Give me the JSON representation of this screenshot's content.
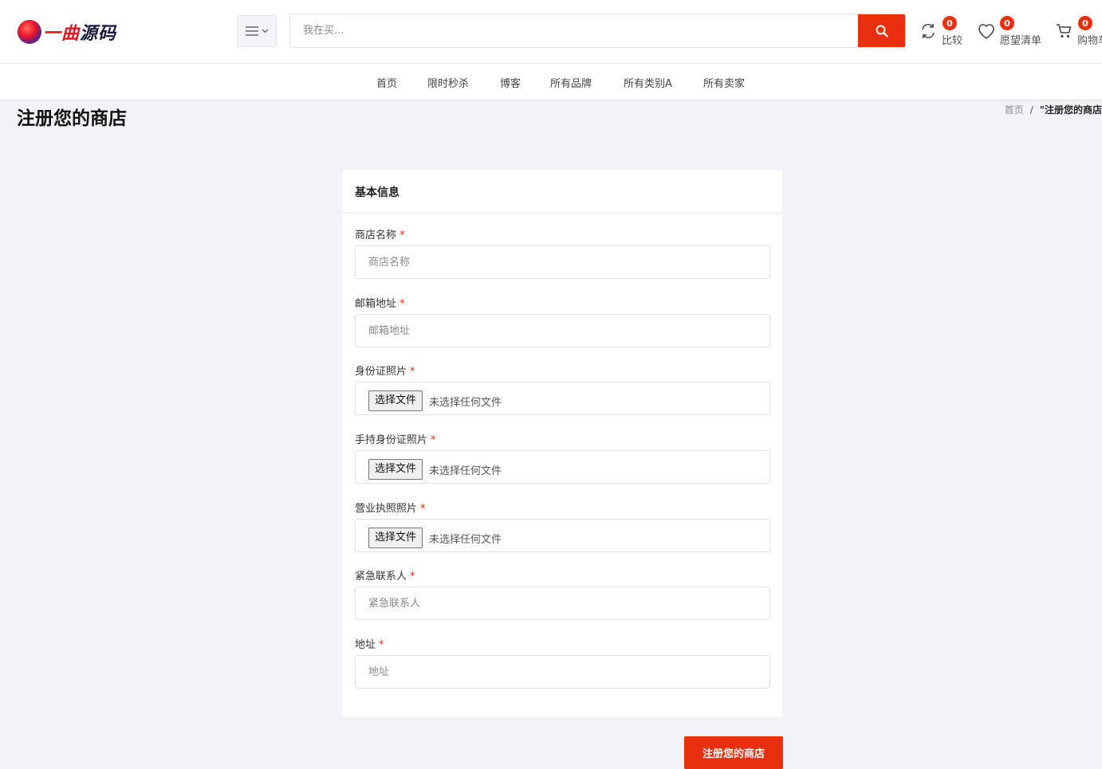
{
  "header": {
    "logo_text_red": "一曲",
    "logo_text_dark": "源码",
    "search_placeholder": "我在买...",
    "compare": {
      "count": "0",
      "label": "比较"
    },
    "wishlist": {
      "count": "0",
      "label": "愿望清单"
    },
    "cart": {
      "count": "0",
      "label": "购物车"
    }
  },
  "nav": {
    "items": [
      "首页",
      "限时秒杀",
      "博客",
      "所有品牌",
      "所有类别A",
      "所有卖家"
    ]
  },
  "page": {
    "title": "注册您的商店",
    "breadcrumb_home": "首页",
    "breadcrumb_sep": "/",
    "breadcrumb_current": "\"注册您的商店"
  },
  "form": {
    "section_title": "基本信息",
    "shop_name": {
      "label": "商店名称",
      "placeholder": "商店名称"
    },
    "email": {
      "label": "邮箱地址",
      "placeholder": "邮箱地址"
    },
    "id_photo": {
      "label": "身份证照片",
      "button": "选择文件",
      "status": "未选择任何文件"
    },
    "hand_id_photo": {
      "label": "手持身份证照片",
      "button": "选择文件",
      "status": "未选择任何文件"
    },
    "license_photo": {
      "label": "营业执照照片",
      "button": "选择文件",
      "status": "未选择任何文件"
    },
    "emergency_contact": {
      "label": "紧急联系人",
      "placeholder": "紧急联系人"
    },
    "address": {
      "label": "地址",
      "placeholder": "地址"
    },
    "required_mark": "*",
    "submit_label": "注册您的商店"
  },
  "colors": {
    "accent": "#e8300f",
    "background": "#f1f3f7"
  }
}
